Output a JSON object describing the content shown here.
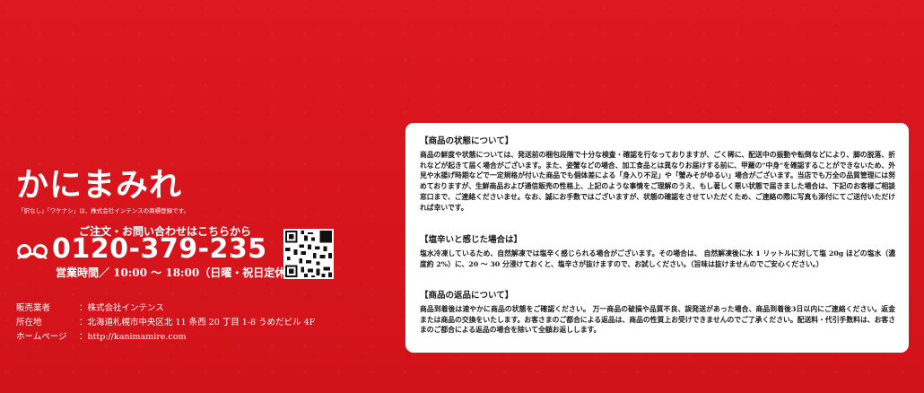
{
  "brand": {
    "name": "かにまみれ",
    "trademark_note": "「訳なし」「ワケナシ」は、株式会社インテンスの商標登録です。"
  },
  "contact": {
    "lead": "ご注文・お問い合わせはこちらから",
    "phone": "0120-379-235",
    "hours": "営業時間／ 10:00 ～ 18:00（日曜・祝日定休）"
  },
  "company": {
    "rows": [
      {
        "label": "販売業者",
        "value": "：株式会社インテンス"
      },
      {
        "label": "所在地",
        "value": "：北海道札幌市中央区北 11 条西 20 丁目 1-8 うめだビル 4F"
      },
      {
        "label": "ホームページ",
        "value": "：http://kanimamire.com"
      }
    ]
  },
  "notice": {
    "sections": [
      {
        "heading": "【商品の状態について】",
        "body": "商品の鮮度や状態については、発送前の梱包段階で十分な検査・確認を行なっておりますが、ごく稀に、配送中の振動や転倒などにより、脚の脱落、折れなどが起きて届く場合がございます。また、姿蟹などの場合、加工食品とは異なりお届けする前に、甲羅の\"中身\"を確認することができないため、外見や水揚げ時期などで一定規格が付いた商品でも個体差による「身入り不足」や「蟹みそがゆるい」場合がございます。当店でも万全の品質管理には努めておりますが、生鮮商品および通信販売の性格上、上記のような事情をご理解のうえ、もし著しく悪い状態で届きました場合は、下記のお客様ご相談窓口まで、ご連絡くださいませ。なお、誠にお手数ではございますが、状態の確認をさせていただくため、ご連絡の際に写真も添付にてご送付いただければ幸いです。"
      },
      {
        "heading": "【塩辛いと感じた場合は】",
        "body": "塩水冷凍しているため、自然解凍では塩辛く感じられる場合がございます。その場合は、 自然解凍後に水 1 リットルに対して塩 20g ほどの塩水（濃度約 2%）に、20 ～ 30 分浸けておくと、塩辛さが抜けますので、お試しください。（旨味は抜けませんのでご安心ください。）"
      },
      {
        "heading": "【商品の返品について】",
        "body": "商品到着後は速やかに商品の状態をご確認ください。 万一商品の破損や品質不良、誤発送があった場合、商品到着後3日以内にご連絡ください。返金または商品の交換をいたします。お客さまのご都合による返品は、商品の性質上お受けできませんのでご了承ください。配送料・代引手数料は、お客さまのご都合による返品の場合を除いて全額お返しします。"
      }
    ]
  },
  "colors": {
    "background": "#d8131c",
    "panel": "#ffffff",
    "text_on_red": "#ffffff"
  },
  "icons": {
    "freedial": "freedial-icon",
    "qr": "qr-code-icon"
  }
}
